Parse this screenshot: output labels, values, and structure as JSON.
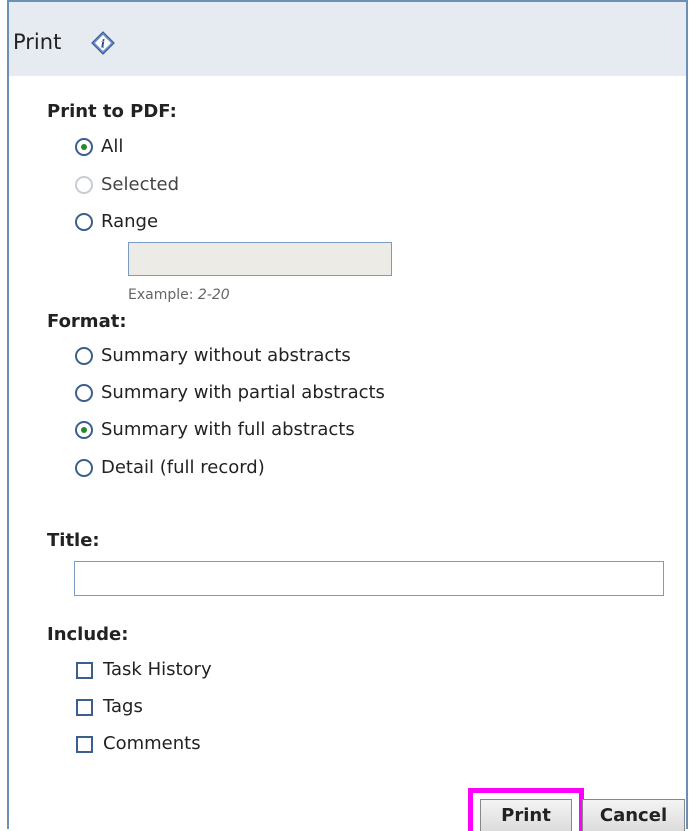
{
  "dialog": {
    "title": "Print",
    "info_icon": "info-icon"
  },
  "print_to_pdf": {
    "label": "Print to PDF:",
    "options": [
      {
        "label": "All",
        "checked": true,
        "disabled": false
      },
      {
        "label": "Selected",
        "checked": false,
        "disabled": true
      },
      {
        "label": "Range",
        "checked": false,
        "disabled": false
      }
    ],
    "range_value": "",
    "example_prefix": "Example: ",
    "example_value": "2-20"
  },
  "format": {
    "label": "Format:",
    "options": [
      {
        "label": "Summary without abstracts",
        "checked": false
      },
      {
        "label": "Summary with partial abstracts",
        "checked": false
      },
      {
        "label": "Summary with full abstracts",
        "checked": true
      },
      {
        "label": "Detail (full record)",
        "checked": false
      }
    ]
  },
  "title_field": {
    "label": "Title:",
    "value": ""
  },
  "include": {
    "label": "Include:",
    "options": [
      {
        "label": "Task History",
        "checked": false
      },
      {
        "label": "Tags",
        "checked": false
      },
      {
        "label": "Comments",
        "checked": false
      }
    ]
  },
  "buttons": {
    "print_label": "Print",
    "cancel_label": "Cancel"
  },
  "colors": {
    "highlight": "#ff00ff",
    "titlebar_bg": "#e6eaf1",
    "border": "#6c8fb7"
  }
}
